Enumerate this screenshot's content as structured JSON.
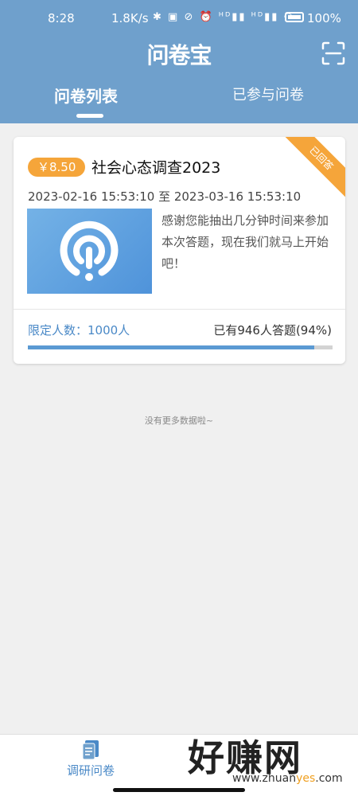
{
  "status_bar": {
    "time": "8:28",
    "speed": "1.8K/s",
    "icons_text": "✱ ▣ ⊘ ⏰ ᴴᴰ▮▮ ᴴᴰ▮▮ ◠",
    "battery_pct": "100%"
  },
  "header": {
    "app_title": "问卷宝",
    "scan_icon": "scan-icon"
  },
  "tabs": [
    {
      "label": "问卷列表",
      "active": true
    },
    {
      "label": "已参与问卷",
      "active": false
    }
  ],
  "survey": {
    "price": "￥8.50",
    "title": "社会心态调查2023",
    "ribbon": "已回答",
    "date_range": "2023-02-16 15:53:10  至  2023-03-16 15:53:10",
    "description": "感谢您能抽出几分钟时间来参加本次答题，现在我们就马上开始吧！",
    "limit": "限定人数：1000人",
    "answered": "已有946人答题(94%)",
    "progress": 0.94
  },
  "list_footer": "没有更多数据啦~",
  "bottom_nav": {
    "item_label": "调研问卷"
  },
  "watermark": {
    "big": "好赚网",
    "small_prefix": "www.zhuan",
    "small_highlight": "yes",
    "small_suffix": ".com"
  },
  "colors": {
    "header_bg": "#6fa0cc",
    "accent_orange": "#f5a53a",
    "accent_blue": "#4a89c7"
  }
}
